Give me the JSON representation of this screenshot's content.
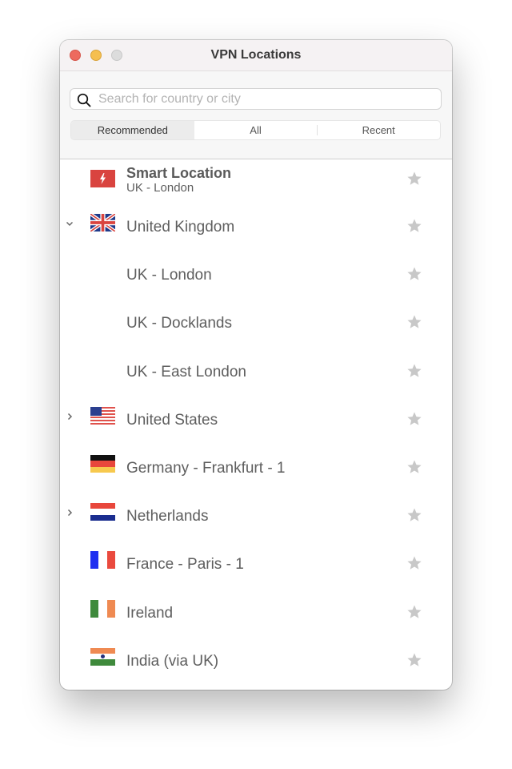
{
  "window": {
    "title": "VPN Locations",
    "controls": {
      "close": "close",
      "minimize": "minimize",
      "zoom": "zoom"
    }
  },
  "search": {
    "placeholder": "Search for country or city",
    "value": "",
    "icon": "search-icon"
  },
  "tabs": [
    {
      "label": "Recommended",
      "active": true
    },
    {
      "label": "All",
      "active": false
    },
    {
      "label": "Recent",
      "active": false
    }
  ],
  "smart_location": {
    "title": "Smart Location",
    "subtitle": "UK - London",
    "icon": "lightning-icon",
    "favorite": false
  },
  "locations": [
    {
      "label": "United Kingdom",
      "flag": "uk",
      "expander": "expanded",
      "favorite": false
    },
    {
      "label": "UK - London",
      "flag": null,
      "expander": null,
      "favorite": false
    },
    {
      "label": "UK - Docklands",
      "flag": null,
      "expander": null,
      "favorite": false
    },
    {
      "label": "UK - East London",
      "flag": null,
      "expander": null,
      "favorite": false
    },
    {
      "label": "United States",
      "flag": "us",
      "expander": "collapsed",
      "favorite": false
    },
    {
      "label": "Germany - Frankfurt - 1",
      "flag": "de",
      "expander": null,
      "favorite": false
    },
    {
      "label": "Netherlands",
      "flag": "nl",
      "expander": "collapsed",
      "favorite": false
    },
    {
      "label": "France - Paris - 1",
      "flag": "fr",
      "expander": null,
      "favorite": false
    },
    {
      "label": "Ireland",
      "flag": "ie",
      "expander": null,
      "favorite": false
    },
    {
      "label": "India (via UK)",
      "flag": "in",
      "expander": null,
      "favorite": false
    }
  ],
  "colors": {
    "smart_red": "#d9443f",
    "star_gray": "#c8c8c8",
    "text": "#5e5e5e"
  }
}
